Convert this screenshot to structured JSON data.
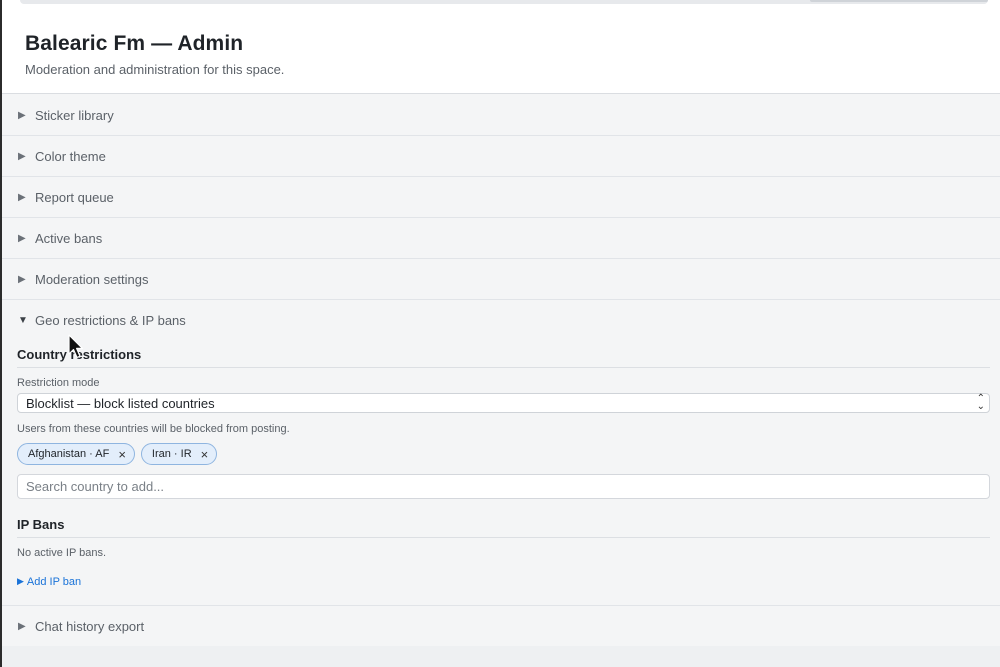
{
  "header": {
    "title": "Balearic Fm — Admin",
    "subtitle": "Moderation and administration for this space."
  },
  "sections": [
    {
      "label": "Sticker library"
    },
    {
      "label": "Color theme"
    },
    {
      "label": "Report queue"
    },
    {
      "label": "Active bans"
    },
    {
      "label": "Moderation settings"
    }
  ],
  "open_section": {
    "label": "Geo restrictions & IP bans",
    "country": {
      "heading": "Country restrictions",
      "mode_label": "Restriction mode",
      "mode_value": "Blocklist — block listed countries",
      "hint": "Users from these countries will be blocked from posting.",
      "chips": [
        {
          "label": "Afghanistan · AF"
        },
        {
          "label": "Iran · IR"
        }
      ],
      "search_placeholder": "Search country to add..."
    },
    "ip": {
      "heading": "IP Bans",
      "empty": "No active IP bans.",
      "add_label": "Add IP ban"
    }
  },
  "last_section": {
    "label": "Chat history export"
  },
  "icons": {
    "collapsed": "triangle-right-icon",
    "expanded": "triangle-down-icon",
    "remove": "close-icon",
    "select": "updown-chevron-icon"
  },
  "colors": {
    "accent": "#1a73d8",
    "chip_bg": "#e3eefb",
    "chip_border": "#8fb5e0"
  }
}
